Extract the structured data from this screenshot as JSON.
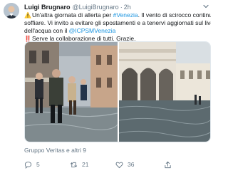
{
  "author": {
    "display_name": "Luigi Brugnaro",
    "handle": "@LuigiBrugnaro",
    "separator": "·",
    "time": "2h",
    "avatar_icon": "avatar-photo"
  },
  "tweet": {
    "line1": {
      "emoji": "⚠️",
      "text_before": "Un'altra giornata di allerta per ",
      "hashtag": "#Venezia",
      "text_after": ". Il vento di scirocco continua a"
    },
    "line2": "soffiare. Vi invito a evitare gli spostamenti e a tenervi aggiornati sul livello",
    "line3": {
      "text_before": "dell'acqua con il ",
      "mention": "@ICPSMVenezia"
    },
    "line4": {
      "emoji": "‼️",
      "text": "Serve la collaborazione di tutti. Grazie."
    }
  },
  "media": {
    "left_photo_icon": "flooded-street-photo",
    "right_photo_icon": "flooded-square-photo"
  },
  "reply_context": "Gruppo Veritas e altri 9",
  "actions": {
    "reply_count": "5",
    "retweet_count": "21",
    "like_count": "36"
  },
  "colors": {
    "link": "#1b95e0",
    "secondary_text": "#657786",
    "primary_text": "#14171a"
  }
}
